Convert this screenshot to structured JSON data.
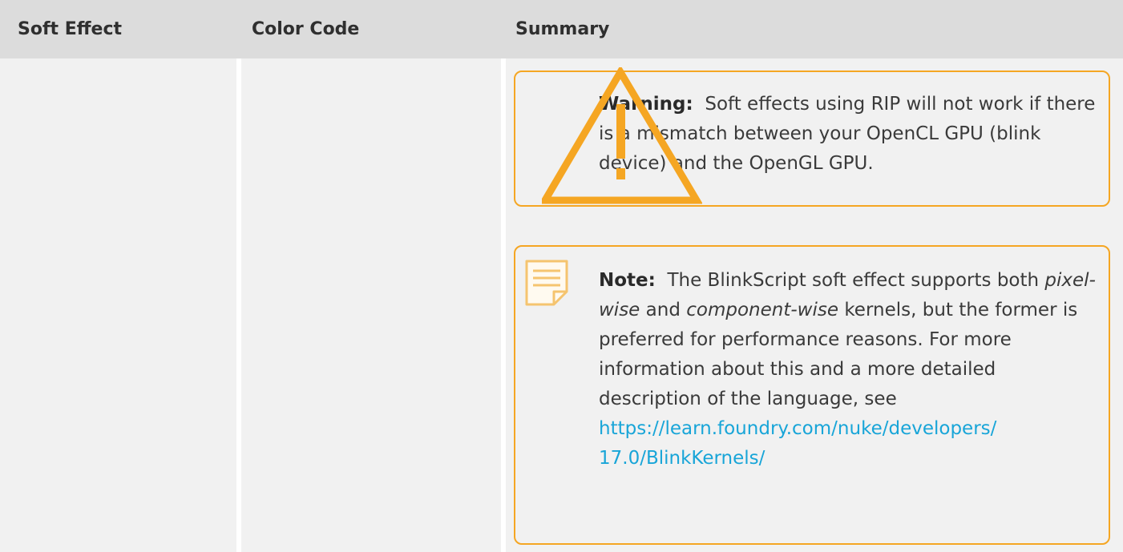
{
  "table": {
    "headers": [
      "Soft Effect",
      "Color Code",
      "Summary"
    ]
  },
  "warning": {
    "icon": "warning-triangle-icon",
    "label": "Warning:",
    "text": "Soft effects using RIP will not work if there is a mismatch between your OpenCL GPU (blink device) and the OpenGL GPU."
  },
  "note": {
    "icon": "note-icon",
    "label": "Note:",
    "text_1": "The BlinkScript soft effect supports both",
    "em_1": "pixel-wise",
    "text_2": "and",
    "em_2": "component-wise",
    "text_3": "kernels, but the former is preferred for performance reasons. For more information about this and a more detailed description of the language, see",
    "link_line_1": "https://learn.foundry.com/nuke/developers/",
    "link_line_2": "17.0/BlinkKernels/"
  },
  "colors": {
    "accent": "#f5a623",
    "link": "#18a5d8",
    "header_bg": "#dcdcdc",
    "cell_bg": "#f1f1f1"
  }
}
